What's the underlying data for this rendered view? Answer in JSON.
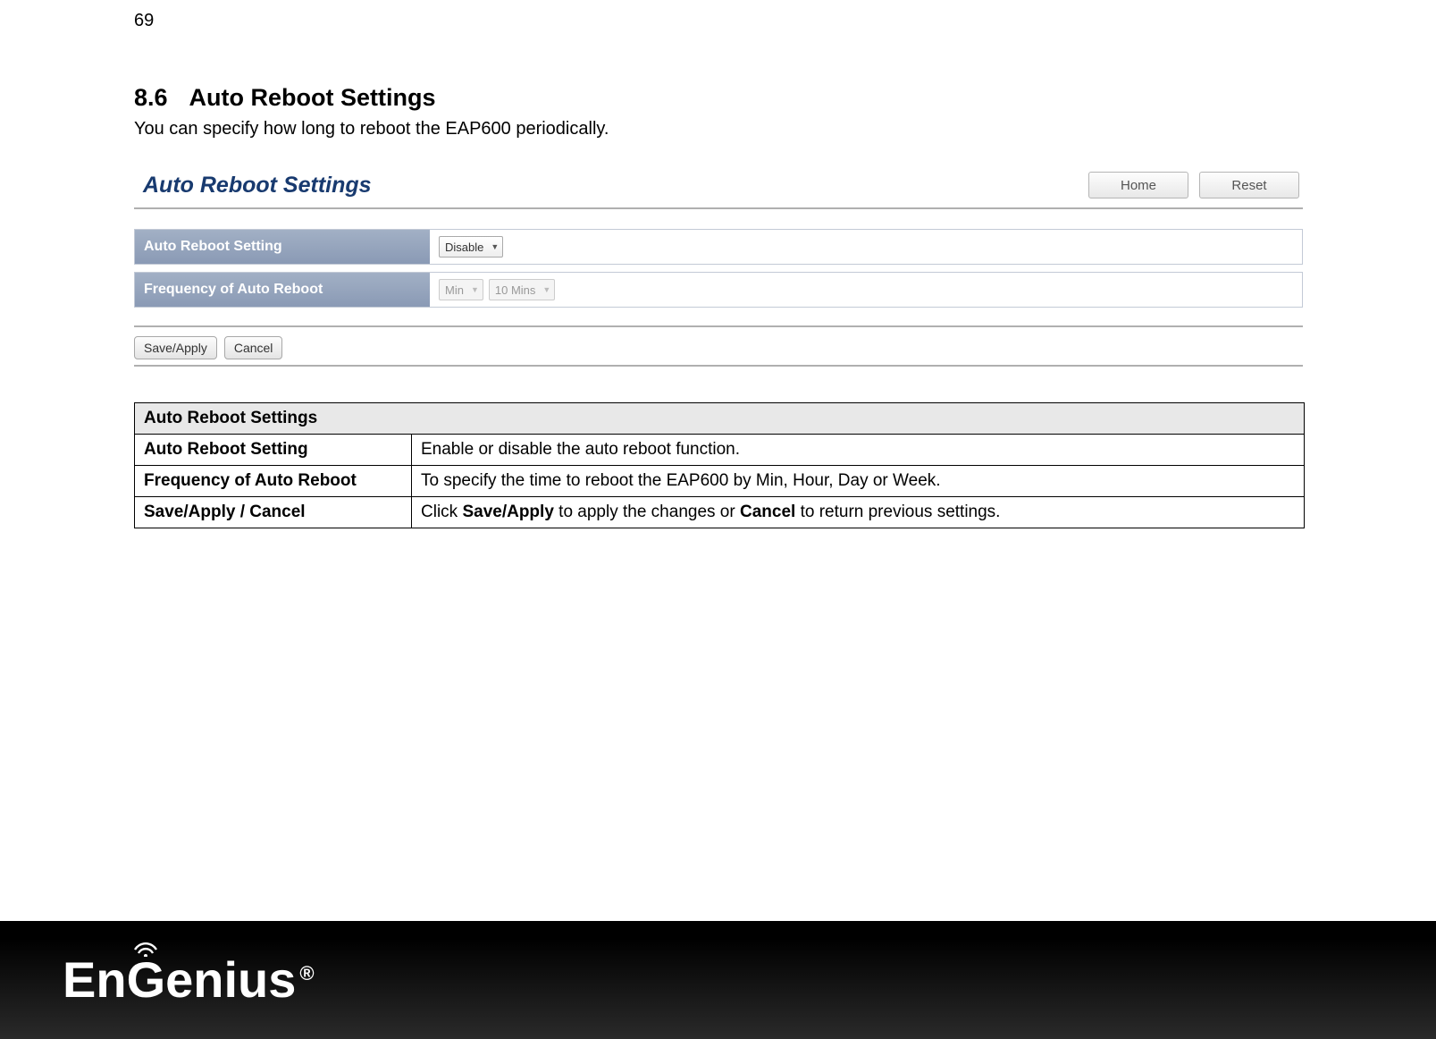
{
  "page_number": "69",
  "heading": {
    "number": "8.6",
    "title": "Auto Reboot Settings"
  },
  "intro": "You can specify how long to reboot the EAP600 periodically.",
  "ui": {
    "panel_title": "Auto Reboot Settings",
    "home_button": "Home",
    "reset_button": "Reset",
    "row1_label": "Auto Reboot Setting",
    "row1_select": "Disable",
    "row2_label": "Frequency of Auto Reboot",
    "row2_select_unit": "Min",
    "row2_select_value": "10 Mins",
    "save_apply": "Save/Apply",
    "cancel": "Cancel"
  },
  "table": {
    "header": "Auto Reboot Settings",
    "rows": [
      {
        "label": "Auto Reboot Setting",
        "desc_plain": "Enable or disable the auto reboot function."
      },
      {
        "label": "Frequency of Auto Reboot",
        "desc_plain": "To specify the time to reboot the EAP600 by Min, Hour, Day or Week."
      },
      {
        "label": "Save/Apply / Cancel",
        "desc_prefix": "Click ",
        "desc_bold1": "Save/Apply",
        "desc_mid": " to apply the changes or ",
        "desc_bold2": "Cancel",
        "desc_suffix": " to return previous settings."
      }
    ]
  },
  "footer": {
    "brand_part1": "En",
    "brand_g": "G",
    "brand_part2": "enius",
    "registered": "®"
  }
}
